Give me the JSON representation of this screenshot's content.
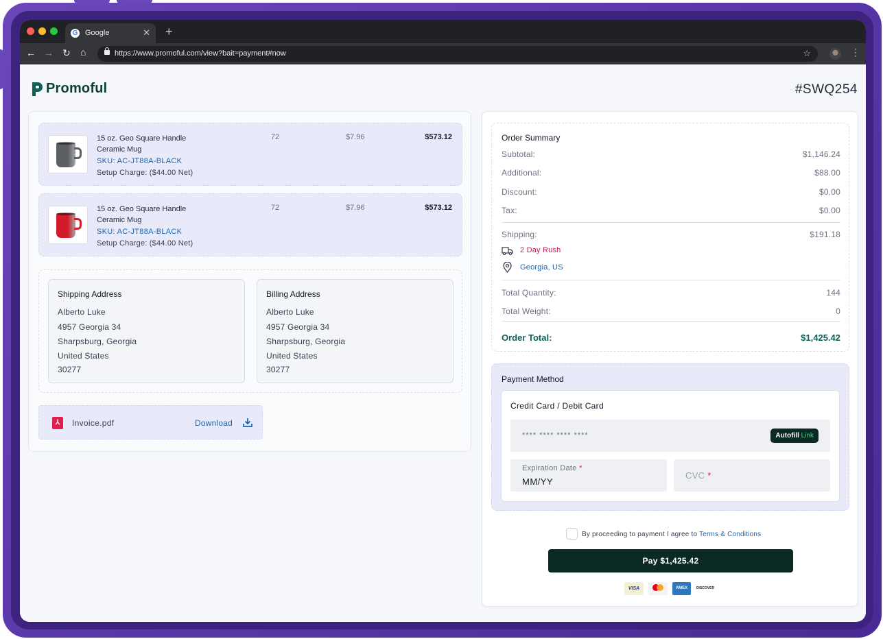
{
  "browser": {
    "tab_title": "Google",
    "url": "https://www.promoful.com/view?bait=payment#now"
  },
  "header": {
    "logo_text": "Promoful",
    "order_id": "#SWQ254"
  },
  "items": [
    {
      "name": "15 oz. Geo Square Handle Ceramic Mug",
      "sku": "SKU: AC-JT88A-BLACK",
      "setup": "Setup Charge: ($44.00 Net)",
      "qty": "72",
      "unit_price": "$7.96",
      "total": "$573.12",
      "color": "#5b5f63"
    },
    {
      "name": "15 oz. Geo Square Handle Ceramic Mug",
      "sku": "SKU: AC-JT88A-BLACK",
      "setup": "Setup Charge: ($44.00 Net)",
      "qty": "72",
      "unit_price": "$7.96",
      "total": "$573.12",
      "color": "#d11a2a"
    }
  ],
  "shipping_address": {
    "title": "Shipping Address",
    "name": "Alberto Luke",
    "street": "4957 Georgia 34",
    "city": "Sharpsburg, Georgia",
    "country": "United States",
    "zip": "30277"
  },
  "billing_address": {
    "title": "Billing Address",
    "name": "Alberto Luke",
    "street": "4957 Georgia 34",
    "city": "Sharpsburg, Georgia",
    "country": "United States",
    "zip": "30277"
  },
  "invoice": {
    "file_name": "Invoice.pdf",
    "download_label": "Download"
  },
  "summary": {
    "title": "Order Summary",
    "subtotal_label": "Subtotal:",
    "subtotal": "$1,146.24",
    "additional_label": "Additional:",
    "additional": "$88.00",
    "discount_label": "Discount:",
    "discount": "$0.00",
    "tax_label": "Tax:",
    "tax": "$0.00",
    "shipping_label": "Shipping:",
    "shipping": "$191.18",
    "shipping_method": "2 Day Rush",
    "shipping_location": "Georgia, US",
    "quantity_label": "Total Quantity:",
    "quantity": "144",
    "weight_label": "Total Weight:",
    "weight": "0",
    "total_label": "Order Total:",
    "total": "$1,425.42"
  },
  "payment": {
    "title": "Payment Method",
    "card_title": "Credit Card / Debit Card",
    "card_placeholder": "**** **** **** ****",
    "autofill_label": "Autofill",
    "autofill_link": "Link",
    "exp_label": "Expiration Date",
    "exp_placeholder": "MM/YY",
    "cvc_placeholder": "CVC",
    "required_mark": "*"
  },
  "terms": {
    "text": "By proceeding to payment I agree to",
    "link": "Terms & Conditions"
  },
  "pay_button": "Pay $1,425.42",
  "card_brands": [
    "VISA",
    "mastercard",
    "AMEX",
    "DISCOVER"
  ],
  "colors": {
    "accent_dark": "#0b2a24",
    "total_green": "#0f6153",
    "link_blue": "#1d64b0",
    "rush_red": "#c2185b",
    "panel_lavender": "#e8eaf9"
  }
}
